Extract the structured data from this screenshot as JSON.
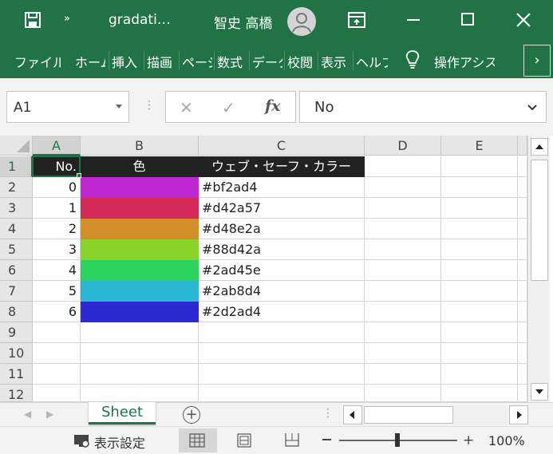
{
  "titlebar": {
    "title": "gradati…",
    "user": "智史 高橋",
    "more_glyph": "»"
  },
  "ribbon": {
    "tabs": [
      "ファイル",
      "ホーム",
      "挿入",
      "描画",
      "ページ",
      "数式",
      "データ",
      "校閲",
      "表示",
      "ヘルプ"
    ],
    "tell_me": "操作アシスト"
  },
  "formula_bar": {
    "name_box": "A1",
    "cancel_glyph": "✕",
    "enter_glyph": "✓",
    "fx_label": "fx",
    "content": "No"
  },
  "grid": {
    "columns": [
      "A",
      "B",
      "C",
      "D",
      "E"
    ],
    "rows": [
      "1",
      "2",
      "3",
      "4",
      "5",
      "6",
      "7",
      "8",
      "9",
      "10",
      "11",
      "12"
    ],
    "header_row": {
      "no": "No.",
      "color": "色",
      "code": "ウェブ・セーフ・カラー"
    },
    "data": [
      {
        "no": "0",
        "swatch": "#bf2ad4",
        "code": "#bf2ad4"
      },
      {
        "no": "1",
        "swatch": "#d42a57",
        "code": "#d42a57"
      },
      {
        "no": "2",
        "swatch": "#d48e2a",
        "code": "#d48e2a"
      },
      {
        "no": "3",
        "swatch": "#88d42a",
        "code": "#88d42a"
      },
      {
        "no": "4",
        "swatch": "#2ad45e",
        "code": "#2ad45e"
      },
      {
        "no": "5",
        "swatch": "#2ab8d4",
        "code": "#2ab8d4"
      },
      {
        "no": "6",
        "swatch": "#2d2ad4",
        "code": "#2d2ad4"
      }
    ]
  },
  "sheets": {
    "active": "Sheet",
    "add_glyph": "+"
  },
  "statusbar": {
    "display_settings": "表示設定",
    "zoom": "100%",
    "zoom_plus": "+"
  },
  "colors": {
    "accent": "#217346",
    "header_fill": "#222222",
    "header_text": "#ffffff"
  }
}
